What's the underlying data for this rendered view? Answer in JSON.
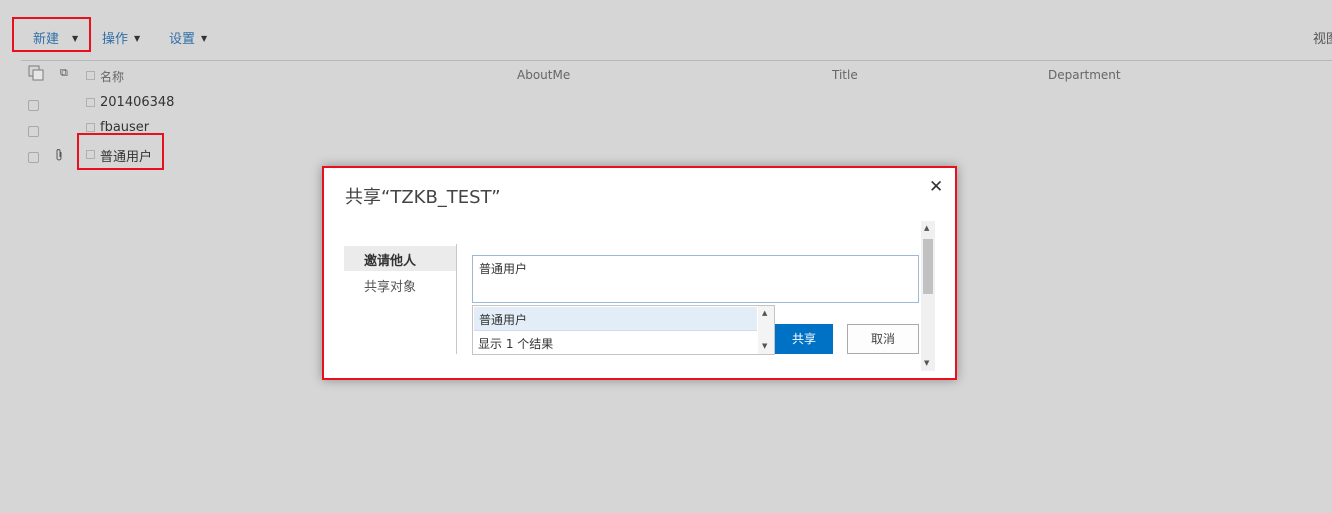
{
  "toolbar": {
    "new_label": "新建",
    "ops_label": "操作",
    "settings_label": "设置",
    "view_label": "视图",
    "caret": "▼"
  },
  "list": {
    "columns": [
      "名称",
      "AboutMe",
      "Title",
      "Department"
    ],
    "rows": [
      {
        "name": "201406348",
        "has_attachment": false
      },
      {
        "name": "fbauser",
        "has_attachment": false
      },
      {
        "name": "普通用户",
        "has_attachment": true
      }
    ]
  },
  "dialog": {
    "title": "共享“TZKB_TEST”",
    "close": "✕",
    "nav": [
      "邀请他人",
      "共享对象"
    ],
    "input_value": "普通用户",
    "suggestions": [
      "普通用户"
    ],
    "result_count_text": "显示 1 个结果",
    "share_label": "共享",
    "cancel_label": "取消"
  },
  "colors": {
    "highlight": "#e8101d",
    "accent": "#0072c6",
    "link": "#2f6fa8",
    "background": "#d6d6d6"
  },
  "icons": {
    "select_all": "select-all-icon",
    "attachment": "paperclip-icon",
    "close": "close-icon",
    "scroll_up": "scroll-up-arrow-icon",
    "scroll_down": "scroll-down-arrow-icon"
  }
}
